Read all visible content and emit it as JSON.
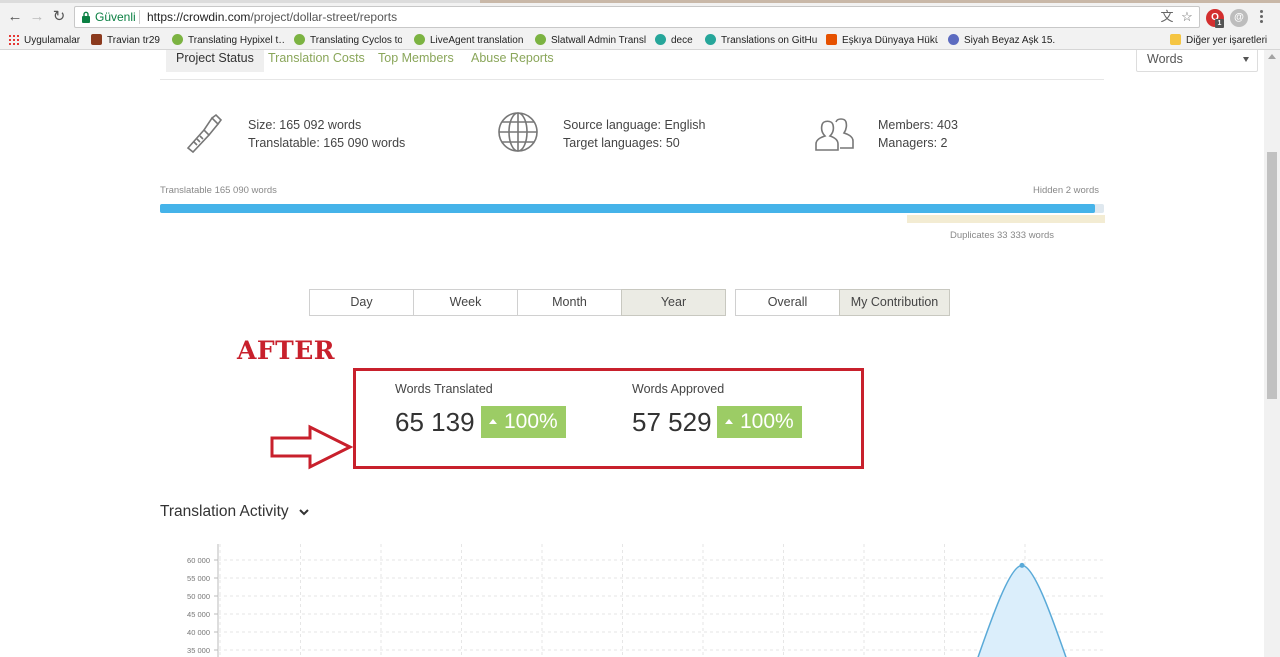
{
  "browser": {
    "secure_label": "Güvenli",
    "url_host": "https://crowdin.com",
    "url_path": "/project/dollar-street/reports",
    "extension_badge": "1"
  },
  "bookmarks": {
    "items": [
      {
        "label": "Uygulamalar",
        "icon": "apps-grid-icon"
      },
      {
        "label": "Travian tr29",
        "icon": "travian-icon",
        "color": "#8b3a1e"
      },
      {
        "label": "Translating Hypixel t…",
        "icon": "crowdin-icon",
        "color": "#7cb342"
      },
      {
        "label": "Translating Cyclos to…",
        "icon": "crowdin-icon",
        "color": "#7cb342"
      },
      {
        "label": "LiveAgent translation…",
        "icon": "crowdin-icon",
        "color": "#7cb342"
      },
      {
        "label": "Slatwall Admin Transl…",
        "icon": "crowdin-icon",
        "color": "#7cb342"
      },
      {
        "label": "dece",
        "icon": "dece-icon",
        "color": "#26a69a"
      },
      {
        "label": "Translations on GitHu…",
        "icon": "translations-icon",
        "color": "#26a69a"
      },
      {
        "label": "Eşkıya Dünyaya Hükü…",
        "icon": "tv-icon",
        "color": "#e65100"
      },
      {
        "label": "Siyah Beyaz Aşk 15. B…",
        "icon": "globe-icon",
        "color": "#5c6bc0"
      }
    ],
    "other_label": "Diğer yer işaretleri"
  },
  "tabs": {
    "items": [
      "Project Status",
      "Translation Costs",
      "Top Members",
      "Abuse Reports"
    ],
    "unit_select": "Words"
  },
  "stats": {
    "size": "Size: 165 092 words",
    "translatable": "Translatable: 165 090 words",
    "source_language": "Source language: English",
    "target_languages": "Target languages: 50",
    "members": "Members: 403",
    "managers": "Managers: 2"
  },
  "progress": {
    "translatable_label": "Translatable 165 090 words",
    "hidden_label": "Hidden 2 words",
    "duplicates_label": "Duplicates 33 333 words",
    "translated_fraction": 0.99
  },
  "periods": {
    "items": [
      "Day",
      "Week",
      "Month",
      "Year"
    ],
    "selected": "Year",
    "scope": [
      "Overall",
      "My Contribution"
    ],
    "scope_selected": "My Contribution"
  },
  "annotation": {
    "label": "AFTER",
    "color": "#c8202c"
  },
  "kpis": {
    "translated_label": "Words Translated",
    "translated_value": "65 139",
    "translated_change": "100%",
    "approved_label": "Words Approved",
    "approved_value": "57 529",
    "approved_change": "100%"
  },
  "activity": {
    "title": "Translation Activity"
  },
  "chart_data": {
    "type": "area",
    "ytick_labels": [
      "60 000",
      "55 000",
      "50 000",
      "45 000",
      "40 000",
      "35 000"
    ],
    "yticks": [
      60000,
      55000,
      50000,
      45000,
      40000,
      35000
    ],
    "ylim": [
      33000,
      63000
    ],
    "peak_value": 58500,
    "colors": {
      "line": "#5aaad8",
      "fill": "#dbeefb"
    }
  }
}
